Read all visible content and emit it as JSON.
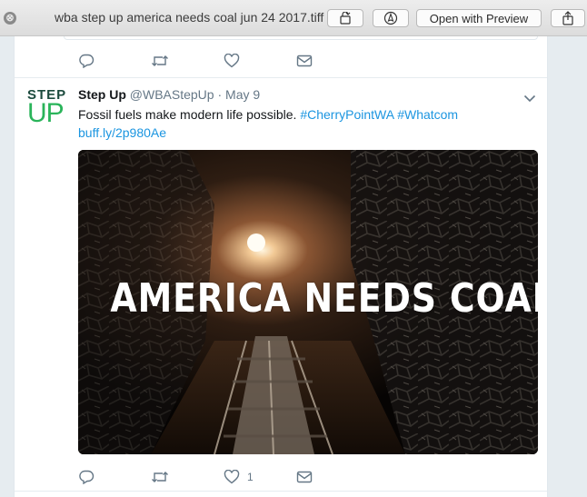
{
  "window": {
    "title": "wba step up america needs coal jun 24 2017.tiff",
    "open_with_label": "Open with Preview",
    "close_glyph": "⊗"
  },
  "avatar": {
    "logo_top": "STEP",
    "logo_bottom": "UP",
    "colors": {
      "dark": "#1c4a3d",
      "green": "#2ab45a"
    }
  },
  "tweet": {
    "display_name": "Step Up",
    "handle": "@WBAStepUp",
    "separator": "·",
    "date": "May 9",
    "text": "Fossil fuels make modern life possible. ",
    "hashtags": [
      "#CherryPointWA",
      "#Whatcom"
    ],
    "link": "buff.ly/2p980Ae",
    "media_caption": "AMERICA NEEDS COAL",
    "like_count": "1"
  },
  "colors": {
    "link": "#1b95e0",
    "text": "#14171a",
    "muted": "#657786"
  },
  "icons": {
    "reply": "reply-icon",
    "retweet": "retweet-icon",
    "like": "heart-icon",
    "message": "envelope-icon",
    "caret": "chevron-down-icon",
    "rotate": "rotate-icon",
    "markup": "markup-pen-icon",
    "share": "share-icon"
  }
}
